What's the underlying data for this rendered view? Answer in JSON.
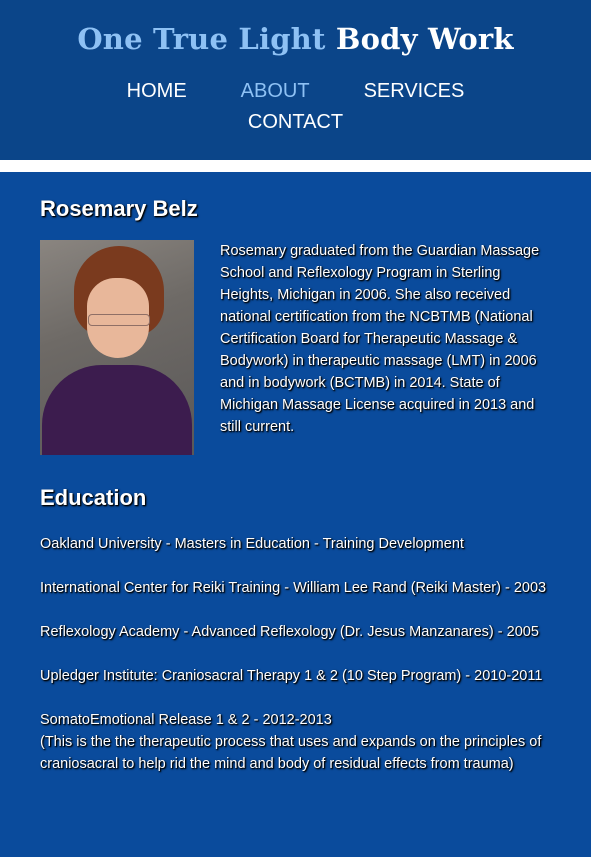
{
  "header": {
    "title_part1": "One True Light",
    "title_part2": "Body Work",
    "nav": {
      "home": "HOME",
      "about": "ABOUT",
      "services": "SERVICES",
      "contact": "CONTACT"
    }
  },
  "colors": {
    "background": "#0a4b9c",
    "header": "#0b4589",
    "accent": "#8ec1f4"
  },
  "profile": {
    "name": "Rosemary Belz",
    "bio": "Rosemary graduated from the Guardian Massage School and Reflexology Program in Sterling Heights, Michigan in 2006. She also received national certification from the NCBTMB (National Certification Board for Therapeutic Massage & Bodywork) in therapeutic massage (LMT) in 2006 and in bodywork (BCTMB) in 2014. State of Michigan Massage License acquired in 2013 and still current."
  },
  "education": {
    "heading": "Education",
    "items": [
      "Oakland University - Masters in Education - Training Development",
      "International Center for Reiki Training - William Lee Rand (Reiki Master) - 2003",
      "Reflexology Academy - Advanced Reflexology (Dr. Jesus Manzanares) - 2005",
      "Upledger Institute: Craniosacral Therapy 1 & 2 (10 Step Program) - 2010-2011",
      "SomatoEmotional Release 1 & 2 - 2012-2013",
      "(This is the the therapeutic process that uses and expands on the principles of craniosacral to help rid the mind and body of residual effects from trauma)"
    ]
  }
}
